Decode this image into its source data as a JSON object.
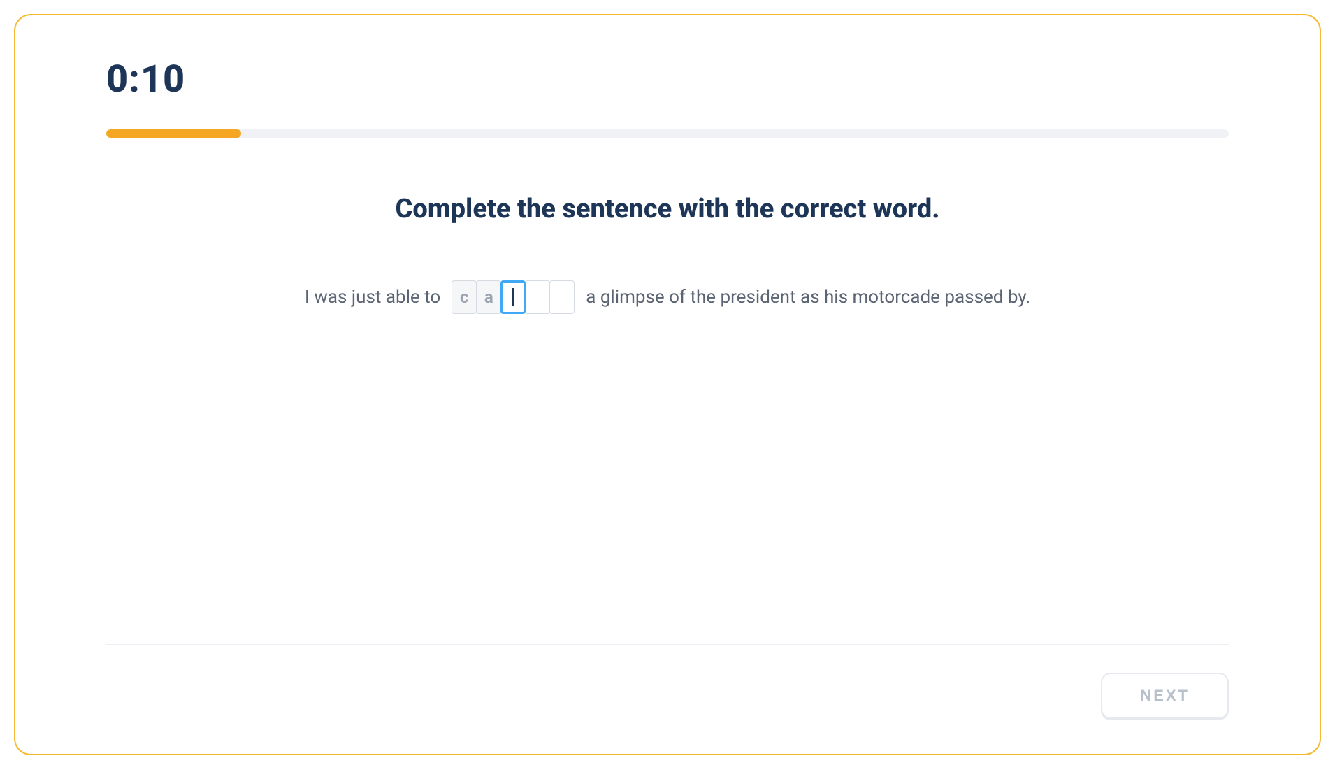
{
  "timer": "0:10",
  "progress_percent": 12,
  "instruction": "Complete the sentence with the correct word.",
  "sentence": {
    "before": "I was just able to",
    "after": "a glimpse of the president as his motorcade passed by."
  },
  "letters": {
    "boxes": [
      "c",
      "a",
      "",
      "",
      ""
    ],
    "filled_count": 2,
    "active_index": 2
  },
  "buttons": {
    "next": "NEXT"
  },
  "colors": {
    "border": "#f5b932",
    "progress_fill": "#f5a623",
    "text_heading": "#1d3557",
    "text_body": "#5a6473",
    "active_border": "#3fa9f5"
  }
}
